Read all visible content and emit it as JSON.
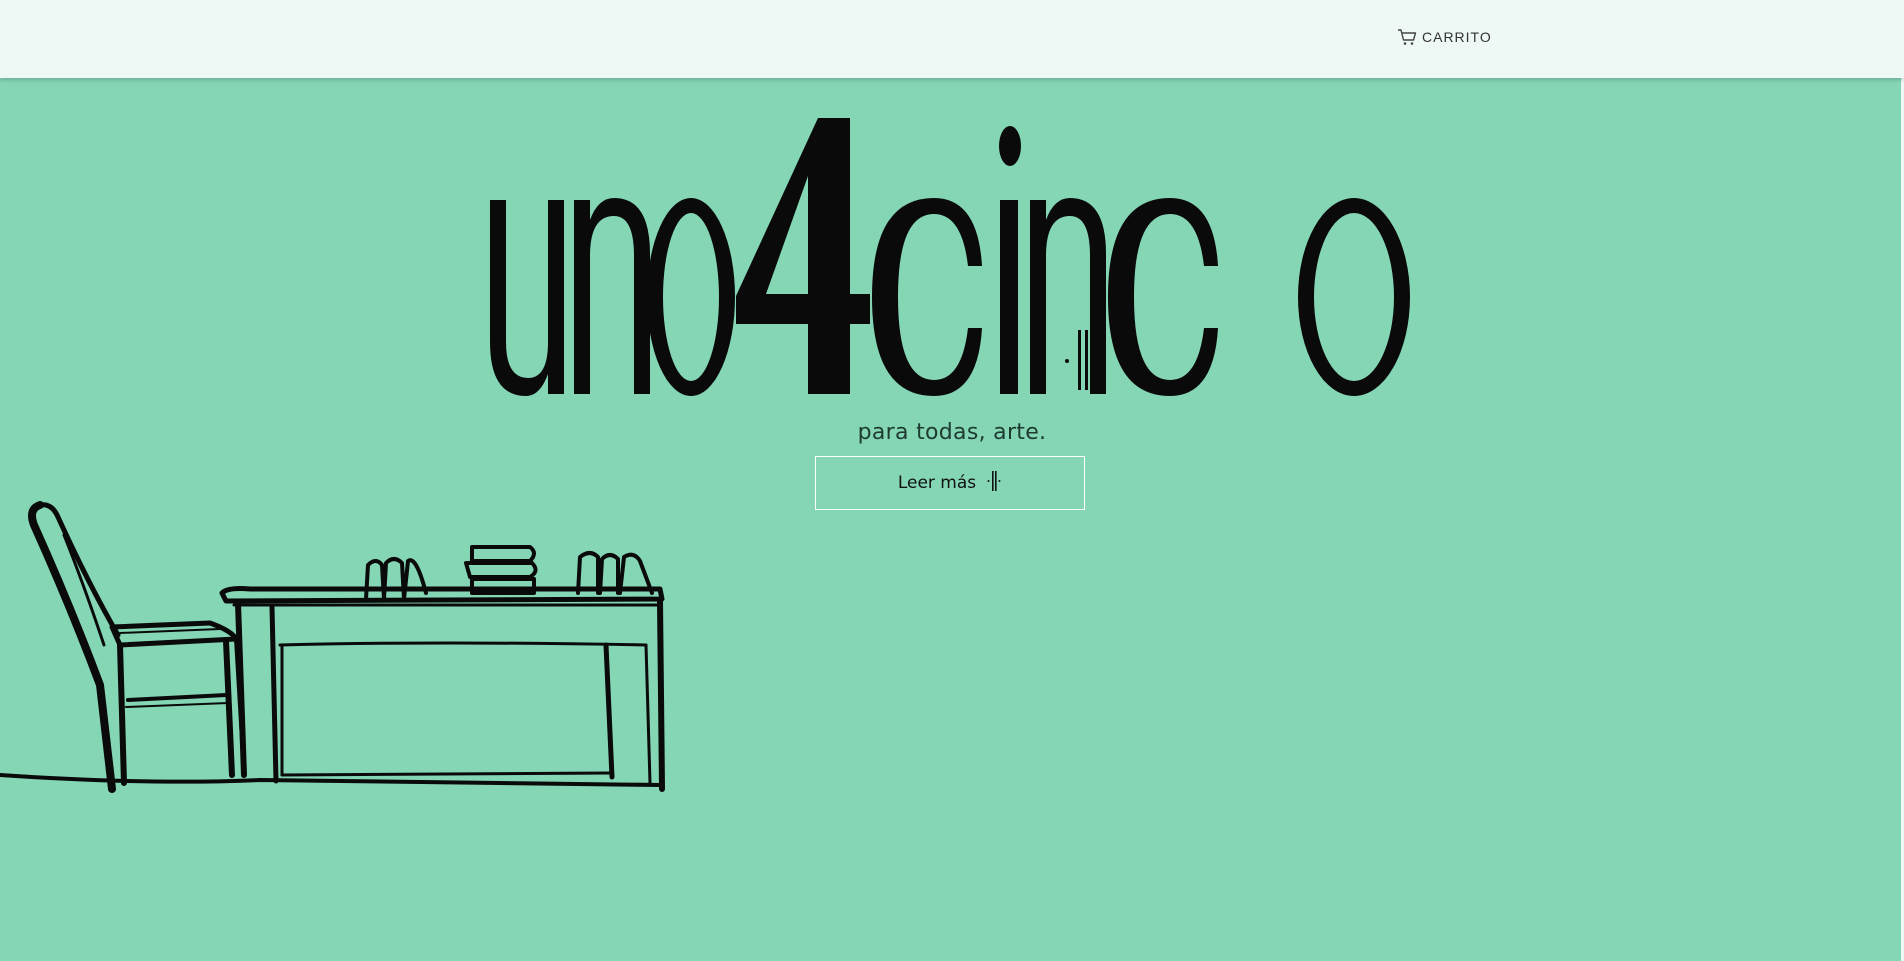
{
  "header": {
    "cart_label": "CARRITO"
  },
  "hero": {
    "brand": "uno4cinco",
    "tagline": "para todas, arte.",
    "read_more_label": "Leer más"
  },
  "colors": {
    "background": "#84d6b5",
    "header_background": "#eef8f4",
    "logo": "#0a0a0a",
    "button_border": "#ffffff"
  },
  "icons": {
    "cart": "shopping-cart-icon",
    "brand_mark": "bars-mark-icon"
  }
}
